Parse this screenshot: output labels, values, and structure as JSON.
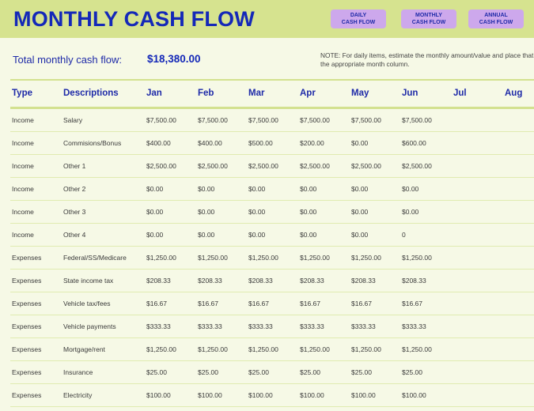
{
  "header": {
    "title": "MONTHLY CASH FLOW",
    "nav_buttons": [
      {
        "line1": "DAILY",
        "line2": "CASH FLOW"
      },
      {
        "line1": "MONTHLY",
        "line2": "CASH FLOW"
      },
      {
        "line1": "ANNUAL",
        "line2": "CASH FLOW"
      }
    ]
  },
  "summary": {
    "total_label": "Total monthly cash flow:",
    "total_value": "$18,380.00",
    "note_line1": "NOTE: For daily items, estimate the monthly amount/value and place that va",
    "note_line2": "the appropriate month column."
  },
  "table": {
    "columns": [
      "Type",
      "Descriptions",
      "Jan",
      "Feb",
      "Mar",
      "Apr",
      "May",
      "Jun",
      "Jul",
      "Aug"
    ],
    "rows": [
      [
        "Income",
        "Salary",
        "$7,500.00",
        "$7,500.00",
        "$7,500.00",
        "$7,500.00",
        "$7,500.00",
        "$7,500.00",
        "",
        ""
      ],
      [
        "Income",
        "Commisions/Bonus",
        "$400.00",
        "$400.00",
        "$500.00",
        "$200.00",
        "$0.00",
        "$600.00",
        "",
        ""
      ],
      [
        "Income",
        "Other 1",
        "$2,500.00",
        "$2,500.00",
        "$2,500.00",
        "$2,500.00",
        "$2,500.00",
        "$2,500.00",
        "",
        ""
      ],
      [
        "Income",
        "Other 2",
        "$0.00",
        "$0.00",
        "$0.00",
        "$0.00",
        "$0.00",
        "$0.00",
        "",
        ""
      ],
      [
        "Income",
        "Other 3",
        "$0.00",
        "$0.00",
        "$0.00",
        "$0.00",
        "$0.00",
        "$0.00",
        "",
        ""
      ],
      [
        "Income",
        "Other 4",
        "$0.00",
        "$0.00",
        "$0.00",
        "$0.00",
        "$0.00",
        "0",
        "",
        ""
      ],
      [
        "Expenses",
        "Federal/SS/Medicare",
        "$1,250.00",
        "$1,250.00",
        "$1,250.00",
        "$1,250.00",
        "$1,250.00",
        "$1,250.00",
        "",
        ""
      ],
      [
        "Expenses",
        "State income tax",
        "$208.33",
        "$208.33",
        "$208.33",
        "$208.33",
        "$208.33",
        "$208.33",
        "",
        ""
      ],
      [
        "Expenses",
        "Vehicle tax/fees",
        "$16.67",
        "$16.67",
        "$16.67",
        "$16.67",
        "$16.67",
        "$16.67",
        "",
        ""
      ],
      [
        "Expenses",
        "Vehicle payments",
        "$333.33",
        "$333.33",
        "$333.33",
        "$333.33",
        "$333.33",
        "$333.33",
        "",
        ""
      ],
      [
        "Expenses",
        "Mortgage/rent",
        "$1,250.00",
        "$1,250.00",
        "$1,250.00",
        "$1,250.00",
        "$1,250.00",
        "$1,250.00",
        "",
        ""
      ],
      [
        "Expenses",
        "Insurance",
        "$25.00",
        "$25.00",
        "$25.00",
        "$25.00",
        "$25.00",
        "$25.00",
        "",
        ""
      ],
      [
        "Expenses",
        "Electricity",
        "$100.00",
        "$100.00",
        "$100.00",
        "$100.00",
        "$100.00",
        "$100.00",
        "",
        ""
      ]
    ]
  }
}
